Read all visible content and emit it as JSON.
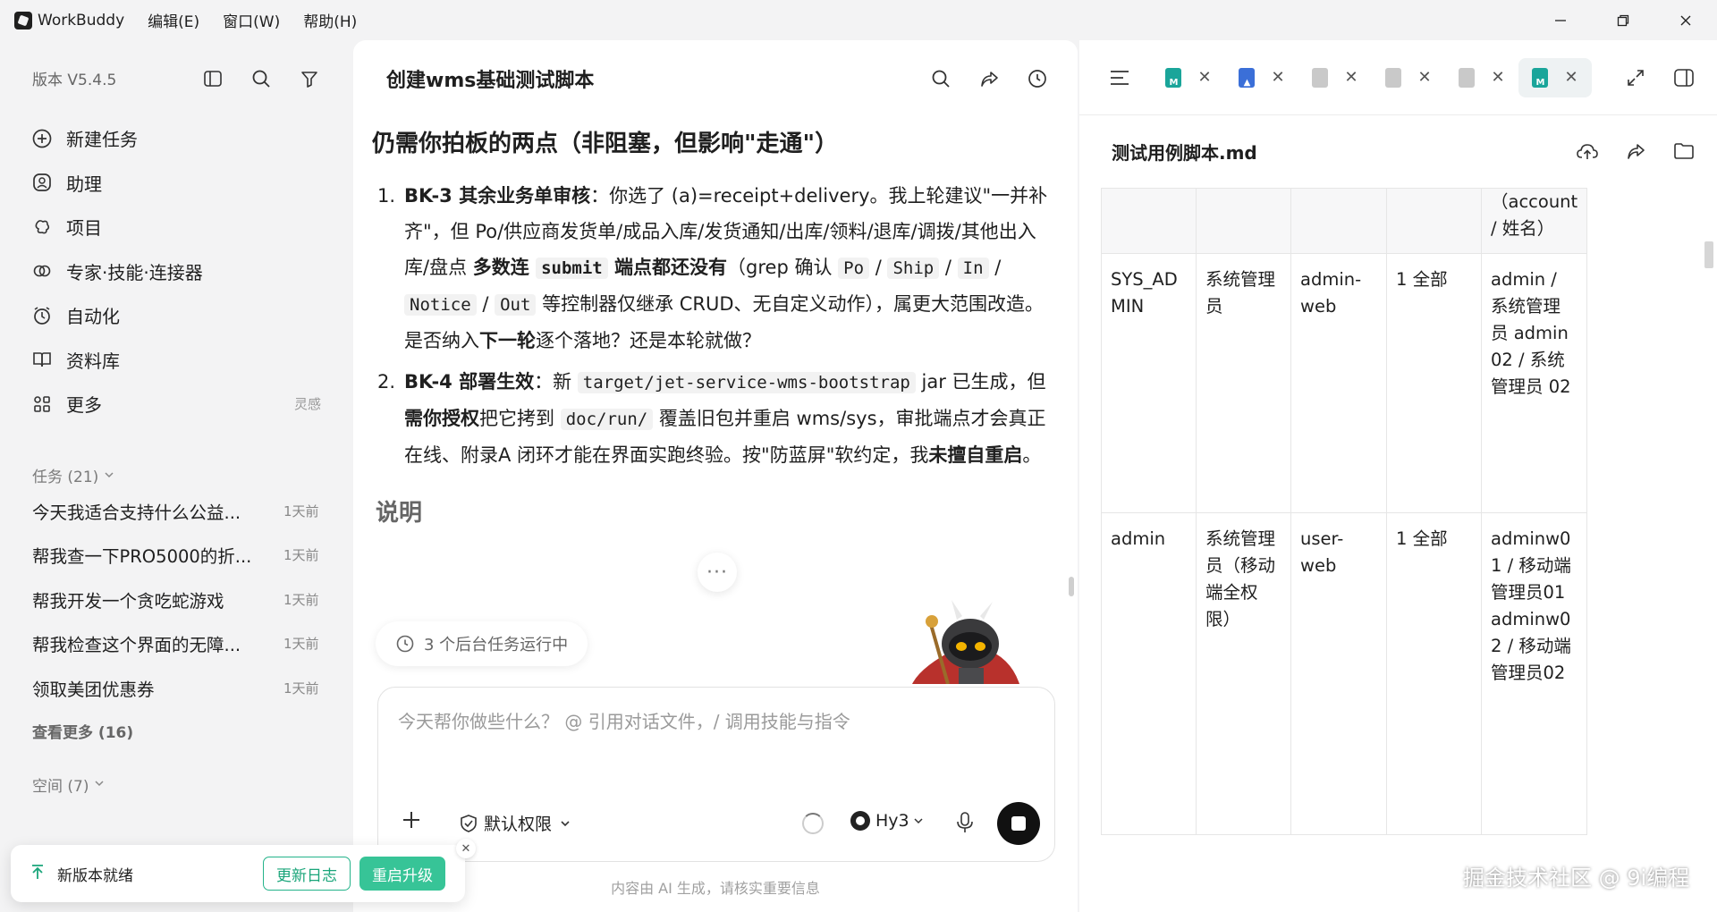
{
  "titlebar": {
    "app_name": "WorkBuddy",
    "menus": [
      "编辑(E)",
      "窗口(W)",
      "帮助(H)"
    ]
  },
  "sidebar": {
    "version": "版本 V5.4.5",
    "nav": [
      {
        "label": "新建任务",
        "icon": "new-task-icon"
      },
      {
        "label": "助理",
        "icon": "assistant-icon"
      },
      {
        "label": "项目",
        "icon": "project-icon"
      },
      {
        "label": "专家·技能·连接器",
        "icon": "expert-icon"
      },
      {
        "label": "自动化",
        "icon": "automation-icon"
      },
      {
        "label": "资料库",
        "icon": "library-icon"
      },
      {
        "label": "更多",
        "icon": "more-grid-icon",
        "hint": "灵感"
      }
    ],
    "tasks_header": "任务 (21)",
    "tasks": [
      {
        "title": "今天我适合支持什么公益...",
        "time": "1天前"
      },
      {
        "title": "帮我查一下PRO5000的折...",
        "time": "1天前"
      },
      {
        "title": "帮我开发一个贪吃蛇游戏",
        "time": "1天前"
      },
      {
        "title": "帮我检查这个界面的无障...",
        "time": "1天前"
      },
      {
        "title": "领取美团优惠券",
        "time": "1天前"
      }
    ],
    "see_more": "查看更多 (16)",
    "space_header": "空间 (7)",
    "update": {
      "text": "新版本就绪",
      "changelog": "更新日志",
      "restart": "重启升级"
    }
  },
  "chat": {
    "title": "创建wms基础测试脚本",
    "heading": "仍需你拍板的两点（非阻塞，但影响\"走通\"）",
    "items": {
      "i1": {
        "num": "1.",
        "b1": "BK-3 其余业务单审核",
        "t1": "：你选了 (a)=receipt+delivery。我上轮建议\"一并补齐\"，但 Po/供应商发货单/成品入库/发货通知/出库/领料/退库/调拨/其他出入库/盘点 ",
        "b2": "多数连 ",
        "code1": "submit",
        "b3": " 端点都还没有",
        "t2": "（grep 确认 ",
        "code2": "Po",
        "s1": " / ",
        "code3": "Ship",
        "s2": " / ",
        "code4": "In",
        "s3": " / ",
        "code5": "Notice",
        "s4": " / ",
        "code6": "Out",
        "t3": " 等控制器仅继承 CRUD、无自定义动作），属更大范围改造。是否纳入",
        "b4": "下一轮",
        "t4": "逐个落地？还是本轮就做？"
      },
      "i2": {
        "num": "2.",
        "b1": "BK-4 部署生效",
        "t1": "：新 ",
        "code1": "target/jet-service-wms-bootstrap",
        "t2": " jar 已生成，但",
        "b2": "需你授权",
        "t3": "把它拷到 ",
        "code2": "doc/run/",
        "t4": " 覆盖旧包并重启 wms/sys，审批端点才会真正在线、附录A 闭环才能在界面实跑终验。按\"防蓝屏\"软约定，我",
        "b3": "未擅自重启",
        "t5": "。"
      }
    },
    "subheading": "说明",
    "more_dots": "···",
    "bg_tasks": "3 个后台任务运行中",
    "composer": {
      "placeholder": "今天帮你做些什么？ @ 引用对话文件，/ 调用技能与指令",
      "permission": "默认权限",
      "model": "Hy3"
    },
    "disclaimer": "内容由 AI 生成，请核实重要信息"
  },
  "right_panel": {
    "tabs": [
      {
        "type": "md",
        "color": "#1aa59a",
        "active": false
      },
      {
        "type": "img",
        "color": "#3b6fd8",
        "active": false
      },
      {
        "type": "file",
        "color": "#c9c9c9",
        "active": false
      },
      {
        "type": "file",
        "color": "#c9c9c9",
        "active": false
      },
      {
        "type": "file",
        "color": "#c9c9c9",
        "active": false
      },
      {
        "type": "md",
        "color": "#1aa59a",
        "active": true
      }
    ],
    "doc_title": "测试用例脚本.md",
    "table": {
      "header_tail": "（account / 姓名）",
      "rows": [
        {
          "c1": "SYS_ADMIN",
          "c2": "系统管理员",
          "c3": "admin-web",
          "c4": "1 全部",
          "c5": "admin / 系统管理员 admin02 / 系统管理员 02"
        },
        {
          "c1": "admin",
          "c2": "系统管理员（移动端全权限）",
          "c3": "user-web",
          "c4": "1 全部",
          "c5": "adminw01 / 移动端管理员01 adminw02 / 移动端管理员02"
        }
      ]
    }
  },
  "watermark": "掘金技术社区 @ 9i编程"
}
